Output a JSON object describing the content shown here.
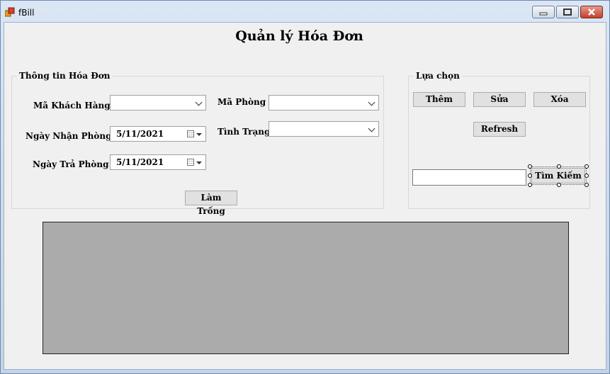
{
  "window": {
    "title": "fBill",
    "accent": "#c0402c"
  },
  "header": {
    "title": "Quản lý Hóa Đơn"
  },
  "invoice_group": {
    "title": "Thông tin Hóa Đơn",
    "customer_code_label": "Mã Khách Hàng",
    "customer_code_value": "",
    "checkin_label": "Ngày Nhận Phòng",
    "checkin_value": "5/11/2021",
    "checkout_label": "Ngày Trả Phòng",
    "checkout_value": "5/11/2021",
    "room_code_label": "Mã Phòng",
    "room_code_value": "",
    "status_label": "Tình Trạng",
    "status_value": "",
    "clear_button": "Làm Trống"
  },
  "options_group": {
    "title": "Lựa chọn",
    "add_button": "Thêm",
    "edit_button": "Sửa",
    "delete_button": "Xóa",
    "refresh_button": "Refresh",
    "search_value": "",
    "search_button": "Tìm Kiếm"
  },
  "icons": {
    "app": "app-icon",
    "minimize": "minimize-icon",
    "maximize": "maximize-icon",
    "close": "close-icon",
    "calendar": "calendar-icon",
    "dropdown": "chevron-down-icon"
  },
  "colors": {
    "grid_background": "#ababab",
    "form_background": "#f0f0f0"
  }
}
